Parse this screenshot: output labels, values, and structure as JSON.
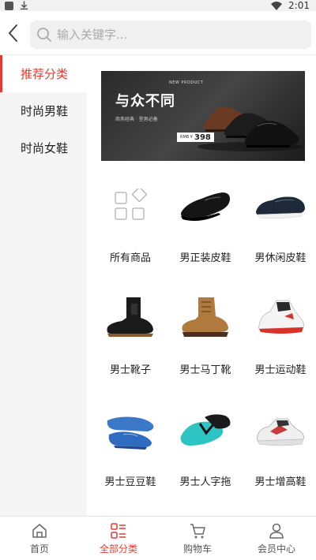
{
  "status_bar": {
    "time": "2:01"
  },
  "search": {
    "placeholder": "输入关键字..."
  },
  "sidebar": {
    "items": [
      {
        "label": "推荐分类",
        "active": true
      },
      {
        "label": "时尚男鞋",
        "active": false
      },
      {
        "label": "时尚女鞋",
        "active": false
      }
    ]
  },
  "banner": {
    "title": "与众不同",
    "new_product": "NEW PRODUCT",
    "subtitle": "商务经典 · 型男必备",
    "price_label": "RMB ¥",
    "price": "398"
  },
  "categories": [
    {
      "label": "所有商品",
      "icon": "grid-shapes-icon"
    },
    {
      "label": "男正装皮鞋",
      "icon": "dress-shoe-image"
    },
    {
      "label": "男休闲皮鞋",
      "icon": "casual-shoe-image"
    },
    {
      "label": "男士靴子",
      "icon": "boot-image"
    },
    {
      "label": "男士马丁靴",
      "icon": "martin-boot-image"
    },
    {
      "label": "男士运动鞋",
      "icon": "sneaker-image"
    },
    {
      "label": "男士豆豆鞋",
      "icon": "loafer-image"
    },
    {
      "label": "男士人字拖",
      "icon": "flip-flop-image"
    },
    {
      "label": "男士增高鞋",
      "icon": "height-shoe-image"
    }
  ],
  "bottom_nav": {
    "items": [
      {
        "label": "首页",
        "icon": "home-icon",
        "active": false
      },
      {
        "label": "全部分类",
        "icon": "category-icon",
        "active": true
      },
      {
        "label": "购物车",
        "icon": "cart-icon",
        "active": false
      },
      {
        "label": "会员中心",
        "icon": "user-icon",
        "active": false
      }
    ]
  },
  "colors": {
    "accent": "#e8382f",
    "sidebar_bg": "#f5f5f5",
    "search_bg": "#f0f0f0"
  }
}
